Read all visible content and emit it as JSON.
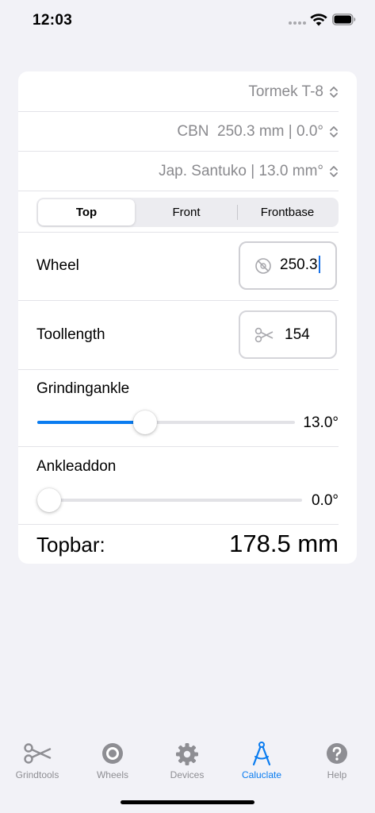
{
  "status": {
    "time": "12:03"
  },
  "pickers": {
    "device": "Tormek T-8",
    "wheel": "CBN  250.3 mm | 0.0°",
    "tool": "Jap. Santuko | 13.0 mm°"
  },
  "segments": {
    "top": "Top",
    "front": "Front",
    "frontbase": "Frontbase",
    "selected": "Top"
  },
  "wheel_field": {
    "label": "Wheel",
    "value": "250.3"
  },
  "toollength_field": {
    "label": "Toollength",
    "value": "154"
  },
  "grinding_angle": {
    "label": "Grindingankle",
    "value_text": "13.0°",
    "level_fraction": 0.41
  },
  "angle_addon": {
    "label": "Ankleaddon",
    "value_text": "0.0°",
    "level_fraction": 0.0
  },
  "result": {
    "label": "Topbar:",
    "value": "178.5 mm"
  },
  "tabs": [
    {
      "label": "Grindtools",
      "icon": "scissors-icon"
    },
    {
      "label": "Wheels",
      "icon": "wheel-icon"
    },
    {
      "label": "Devices",
      "icon": "gear-icon"
    },
    {
      "label": "Caluclate",
      "icon": "compass-icon"
    },
    {
      "label": "Help",
      "icon": "help-icon"
    }
  ],
  "colors": {
    "accent": "#0a7cf0",
    "inactive": "#8e8e93",
    "background": "#f2f2f7"
  }
}
